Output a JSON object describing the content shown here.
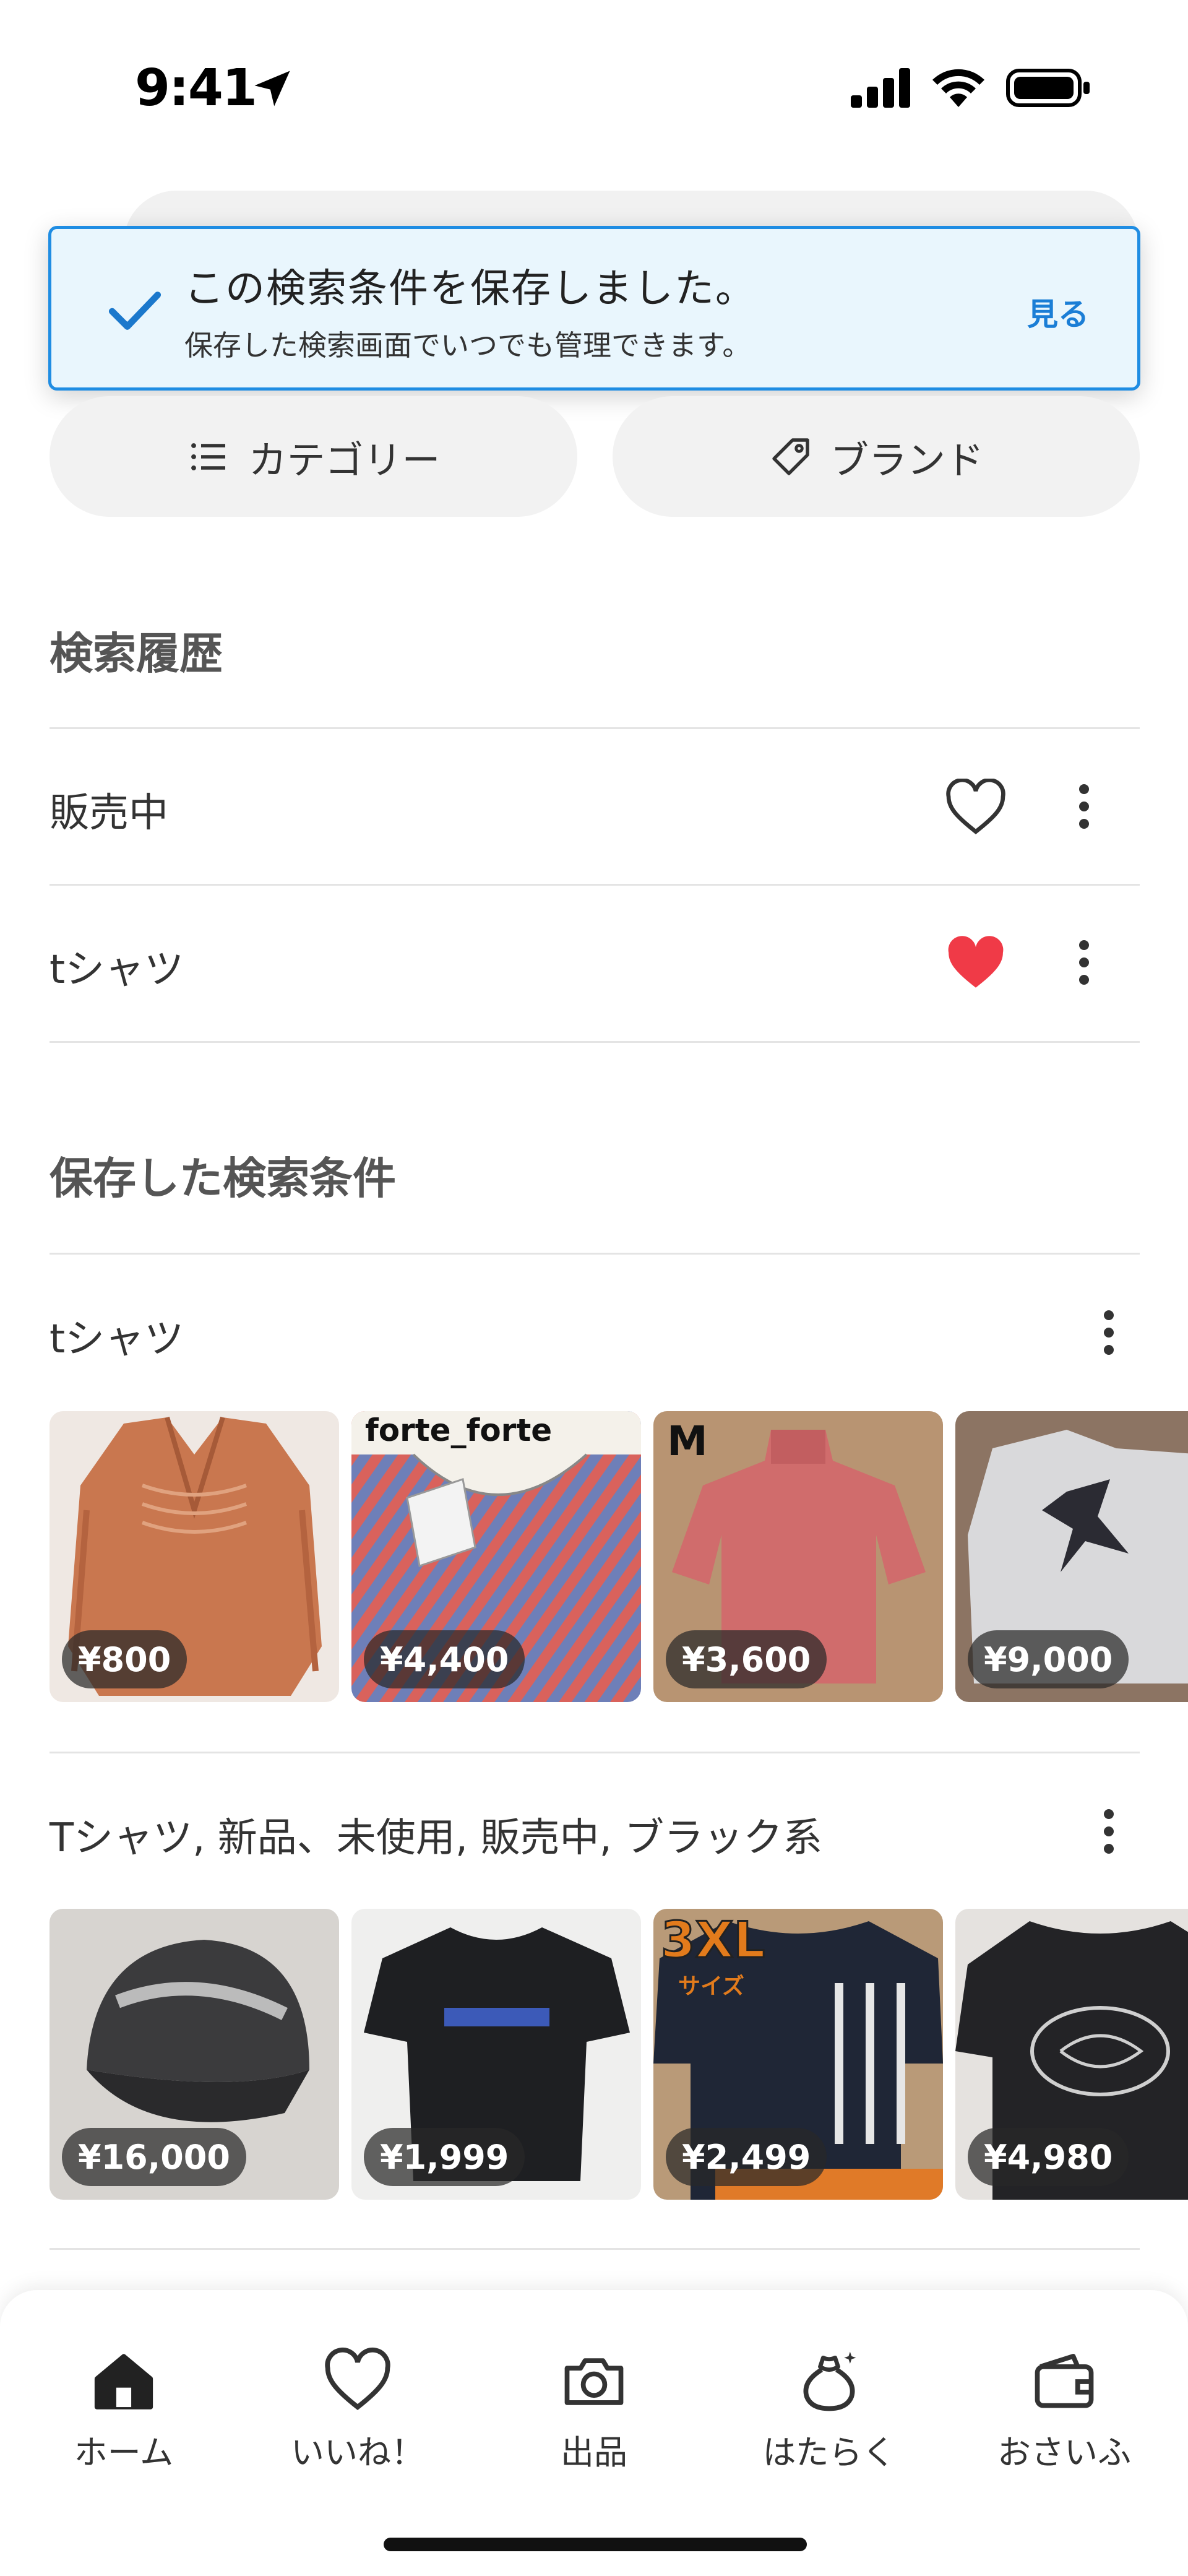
{
  "status_bar": {
    "time": "9:41"
  },
  "toast": {
    "title": "この検索条件を保存しました。",
    "subtitle": "保存した検索画面でいつでも管理できます。",
    "action": "見る",
    "accent": "#1f8de3"
  },
  "filters": {
    "category_label": "カテゴリー",
    "brand_label": "ブランド"
  },
  "history": {
    "heading": "検索履歴",
    "items": [
      {
        "label": "販売中",
        "liked": false
      },
      {
        "label": "tシャツ",
        "liked": true
      }
    ],
    "liked_color": "#f03a47"
  },
  "saved": {
    "heading": "保存した検索条件",
    "searches": [
      {
        "label": "tシャツ",
        "items": [
          {
            "price": "¥800"
          },
          {
            "price": "¥4,400",
            "overlay": "forte_forte"
          },
          {
            "price": "¥3,600",
            "overlay": "M"
          },
          {
            "price": "¥9,000"
          }
        ]
      },
      {
        "label": "Tシャツ, 新品、未使用, 販売中, ブラック系",
        "items": [
          {
            "price": "¥16,000"
          },
          {
            "price": "¥1,999"
          },
          {
            "price": "¥2,499",
            "overlay": "3XL",
            "overlay2": "サイズ"
          },
          {
            "price": "¥4,980"
          }
        ]
      }
    ]
  },
  "nav": {
    "items": [
      {
        "label": "ホーム",
        "icon": "home-icon",
        "active": true
      },
      {
        "label": "いいね！",
        "icon": "heart-icon"
      },
      {
        "label": "出品",
        "icon": "camera-icon"
      },
      {
        "label": "はたらく",
        "icon": "money-bag-icon"
      },
      {
        "label": "おさいふ",
        "icon": "wallet-icon"
      }
    ]
  }
}
